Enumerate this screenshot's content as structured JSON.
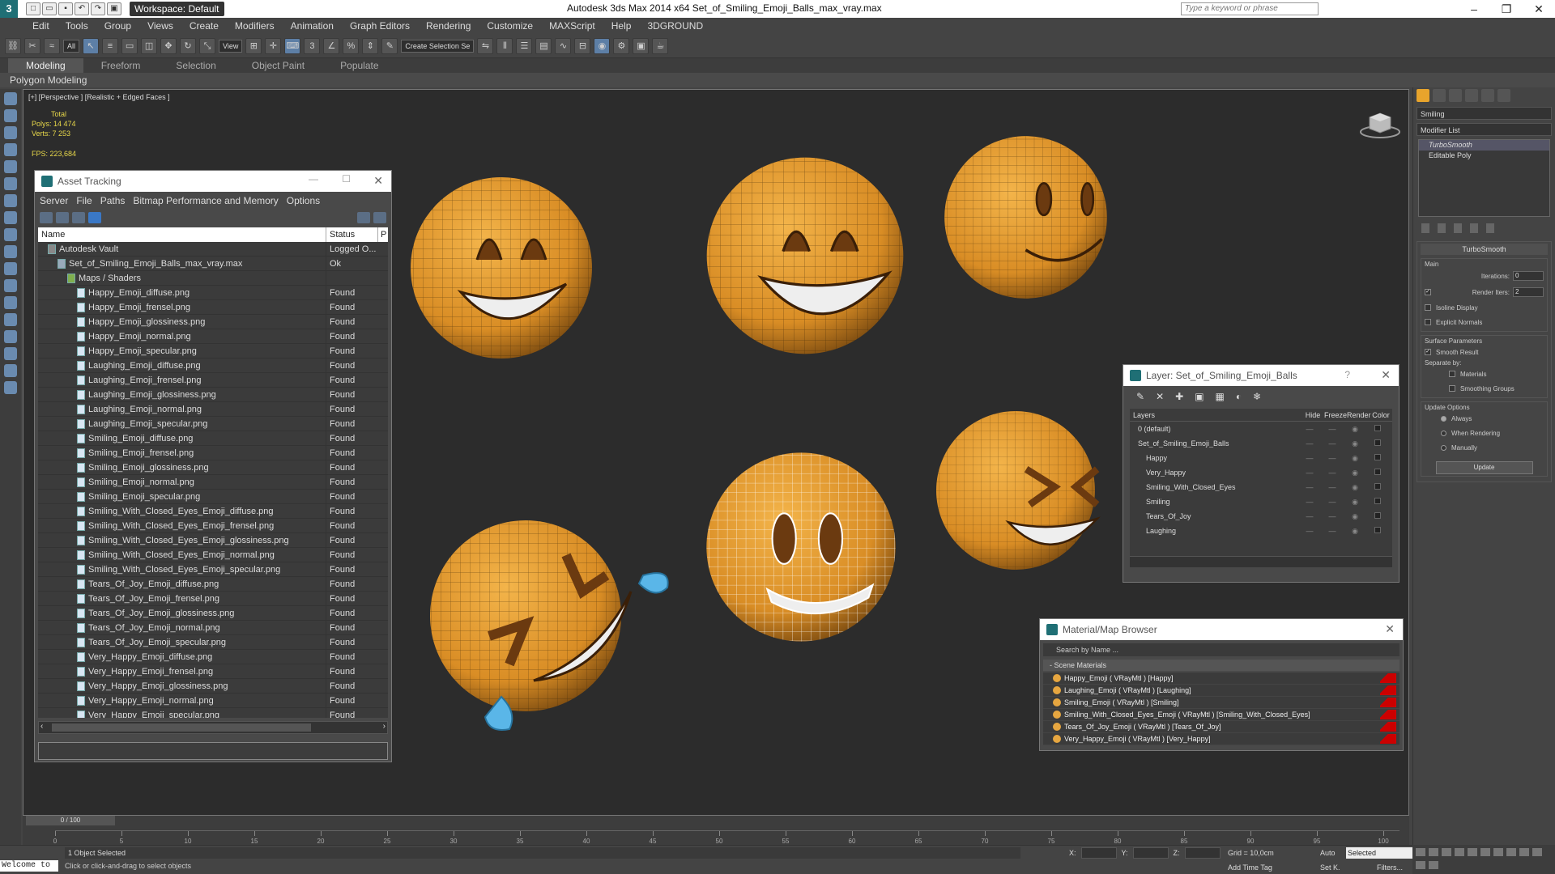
{
  "titlebar": {
    "logo": "3",
    "workspace": "Workspace: Default",
    "title": "Autodesk 3ds Max  2014 x64     Set_of_Smiling_Emoji_Balls_max_vray.max",
    "search_placeholder": "Type a keyword or phrase"
  },
  "menu": [
    "Edit",
    "Tools",
    "Group",
    "Views",
    "Create",
    "Modifiers",
    "Animation",
    "Graph Editors",
    "Rendering",
    "Customize",
    "MAXScript",
    "Help",
    "3DGROUND"
  ],
  "toolbar": {
    "filter": "All",
    "refcoord": "View",
    "named_sel": "Create Selection Se"
  },
  "ribbon": {
    "tabs": [
      "Modeling",
      "Freeform",
      "Selection",
      "Object Paint",
      "Populate"
    ],
    "active": "Modeling",
    "sub": "Polygon Modeling"
  },
  "viewport": {
    "label": "[+] [Perspective ] [Realistic + Edged Faces ]",
    "stats_total": "Total",
    "polys_label": "Polys:",
    "polys": "14 474",
    "verts_label": "Verts:",
    "verts": "7 253",
    "fps_label": "FPS:",
    "fps": "223,684"
  },
  "asset": {
    "title": "Asset Tracking",
    "menu": [
      "Server",
      "File",
      "Paths",
      "Bitmap Performance and Memory",
      "Options"
    ],
    "col_name": "Name",
    "col_status": "Status",
    "col_p": "P",
    "rows": [
      {
        "name": "Autodesk Vault",
        "status": "Logged O...",
        "indent": 1,
        "type": "vault"
      },
      {
        "name": "Set_of_Smiling_Emoji_Balls_max_vray.max",
        "status": "Ok",
        "indent": 2,
        "type": "scene"
      },
      {
        "name": "Maps / Shaders",
        "status": "",
        "indent": 3,
        "type": "folder"
      },
      {
        "name": "Happy_Emoji_diffuse.png",
        "status": "Found",
        "indent": 4,
        "type": "file"
      },
      {
        "name": "Happy_Emoji_frensel.png",
        "status": "Found",
        "indent": 4,
        "type": "file"
      },
      {
        "name": "Happy_Emoji_glossiness.png",
        "status": "Found",
        "indent": 4,
        "type": "file"
      },
      {
        "name": "Happy_Emoji_normal.png",
        "status": "Found",
        "indent": 4,
        "type": "file"
      },
      {
        "name": "Happy_Emoji_specular.png",
        "status": "Found",
        "indent": 4,
        "type": "file"
      },
      {
        "name": "Laughing_Emoji_diffuse.png",
        "status": "Found",
        "indent": 4,
        "type": "file"
      },
      {
        "name": "Laughing_Emoji_frensel.png",
        "status": "Found",
        "indent": 4,
        "type": "file"
      },
      {
        "name": "Laughing_Emoji_glossiness.png",
        "status": "Found",
        "indent": 4,
        "type": "file"
      },
      {
        "name": "Laughing_Emoji_normal.png",
        "status": "Found",
        "indent": 4,
        "type": "file"
      },
      {
        "name": "Laughing_Emoji_specular.png",
        "status": "Found",
        "indent": 4,
        "type": "file"
      },
      {
        "name": "Smiling_Emoji_diffuse.png",
        "status": "Found",
        "indent": 4,
        "type": "file"
      },
      {
        "name": "Smiling_Emoji_frensel.png",
        "status": "Found",
        "indent": 4,
        "type": "file"
      },
      {
        "name": "Smiling_Emoji_glossiness.png",
        "status": "Found",
        "indent": 4,
        "type": "file"
      },
      {
        "name": "Smiling_Emoji_normal.png",
        "status": "Found",
        "indent": 4,
        "type": "file"
      },
      {
        "name": "Smiling_Emoji_specular.png",
        "status": "Found",
        "indent": 4,
        "type": "file"
      },
      {
        "name": "Smiling_With_Closed_Eyes_Emoji_diffuse.png",
        "status": "Found",
        "indent": 4,
        "type": "file"
      },
      {
        "name": "Smiling_With_Closed_Eyes_Emoji_frensel.png",
        "status": "Found",
        "indent": 4,
        "type": "file"
      },
      {
        "name": "Smiling_With_Closed_Eyes_Emoji_glossiness.png",
        "status": "Found",
        "indent": 4,
        "type": "file"
      },
      {
        "name": "Smiling_With_Closed_Eyes_Emoji_normal.png",
        "status": "Found",
        "indent": 4,
        "type": "file"
      },
      {
        "name": "Smiling_With_Closed_Eyes_Emoji_specular.png",
        "status": "Found",
        "indent": 4,
        "type": "file"
      },
      {
        "name": "Tears_Of_Joy_Emoji_diffuse.png",
        "status": "Found",
        "indent": 4,
        "type": "file"
      },
      {
        "name": "Tears_Of_Joy_Emoji_frensel.png",
        "status": "Found",
        "indent": 4,
        "type": "file"
      },
      {
        "name": "Tears_Of_Joy_Emoji_glossiness.png",
        "status": "Found",
        "indent": 4,
        "type": "file"
      },
      {
        "name": "Tears_Of_Joy_Emoji_normal.png",
        "status": "Found",
        "indent": 4,
        "type": "file"
      },
      {
        "name": "Tears_Of_Joy_Emoji_specular.png",
        "status": "Found",
        "indent": 4,
        "type": "file"
      },
      {
        "name": "Very_Happy_Emoji_diffuse.png",
        "status": "Found",
        "indent": 4,
        "type": "file"
      },
      {
        "name": "Very_Happy_Emoji_frensel.png",
        "status": "Found",
        "indent": 4,
        "type": "file"
      },
      {
        "name": "Very_Happy_Emoji_glossiness.png",
        "status": "Found",
        "indent": 4,
        "type": "file"
      },
      {
        "name": "Very_Happy_Emoji_normal.png",
        "status": "Found",
        "indent": 4,
        "type": "file"
      },
      {
        "name": "Very_Happy_Emoji_specular.png",
        "status": "Found",
        "indent": 4,
        "type": "file"
      }
    ]
  },
  "layer": {
    "title": "Layer: Set_of_Smiling_Emoji_Balls",
    "help": "?",
    "col_layers": "Layers",
    "col_hide": "Hide",
    "col_freeze": "Freeze",
    "col_render": "Render",
    "col_color": "Color",
    "rows": [
      {
        "name": "0 (default)",
        "indent": 1
      },
      {
        "name": "Set_of_Smiling_Emoji_Balls",
        "indent": 1
      },
      {
        "name": "Happy",
        "indent": 2
      },
      {
        "name": "Very_Happy",
        "indent": 2
      },
      {
        "name": "Smiling_With_Closed_Eyes",
        "indent": 2
      },
      {
        "name": "Smiling",
        "indent": 2
      },
      {
        "name": "Tears_Of_Joy",
        "indent": 2
      },
      {
        "name": "Laughing",
        "indent": 2
      }
    ]
  },
  "matbrowser": {
    "title": "Material/Map Browser",
    "search": "Search by Name ...",
    "group": "- Scene Materials",
    "items": [
      "Happy_Emoji  ( VRayMtl ) [Happy]",
      "Laughing_Emoji  ( VRayMtl ) [Laughing]",
      "Smiling_Emoji  ( VRayMtl ) [Smiling]",
      "Smiling_With_Closed_Eyes_Emoji  ( VRayMtl ) [Smiling_With_Closed_Eyes]",
      "Tears_Of_Joy_Emoji  ( VRayMtl ) [Tears_Of_Joy]",
      "Very_Happy_Emoji  ( VRayMtl ) [Very_Happy]"
    ]
  },
  "cmd": {
    "objname": "Smiling",
    "modlist": "Modifier List",
    "stack": [
      "TurboSmooth",
      "Editable Poly"
    ],
    "turbosmooth": "TurboSmooth",
    "main": "Main",
    "iterations_label": "Iterations:",
    "iterations": "0",
    "renderiters_label": "Render Iters:",
    "renderiters": "2",
    "isoline": "Isoline Display",
    "explicit": "Explicit Normals",
    "surface": "Surface Parameters",
    "smooth": "Smooth Result",
    "separate": "Separate by:",
    "materials": "Materials",
    "smoothgroups": "Smoothing Groups",
    "update_options": "Update Options",
    "always": "Always",
    "when_rendering": "When Rendering",
    "manually": "Manually",
    "update_btn": "Update"
  },
  "timeline": {
    "slider": "0 / 100",
    "ticks": [
      0,
      5,
      10,
      15,
      20,
      25,
      30,
      35,
      40,
      45,
      50,
      55,
      60,
      65,
      70,
      75,
      80,
      85,
      90,
      95,
      100
    ]
  },
  "status": {
    "welcome": "Welcome to",
    "selected": "1 Object Selected",
    "prompt": "Click or click-and-drag to select objects",
    "x": "X:",
    "y": "Y:",
    "z": "Z:",
    "grid": "Grid = 10,0cm",
    "addtime": "Add Time Tag",
    "auto": "Auto",
    "setk": "Set K.",
    "selected_mode": "Selected",
    "filters": "Filters..."
  }
}
